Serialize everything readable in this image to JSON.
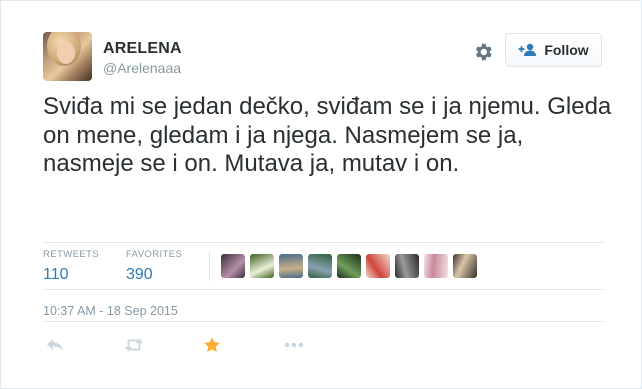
{
  "user": {
    "name": "ARELENA",
    "handle": "@Arelenaaa"
  },
  "follow_button": {
    "label": "Follow",
    "icon": "person-plus-icon"
  },
  "tweet": {
    "text": "Sviđa mi se jedan dečko, sviđam se i ja njemu. Gleda on mene, gledam i ja njega. Nasmejem se ja, nasmeje se i on. Mutava ja, mutav i on."
  },
  "stats": {
    "retweets_label": "RETWEETS",
    "retweets_value": "110",
    "favorites_label": "FAVORITES",
    "favorites_value": "390"
  },
  "favoriters": [
    {
      "color_a": "#3b2f3a",
      "color_b": "#b58fa8"
    },
    {
      "color_a": "#3f5e1e",
      "color_b": "#e9f0d8"
    },
    {
      "color_a": "#4a6b8a",
      "color_b": "#c9b08a"
    },
    {
      "color_a": "#2f5f3a",
      "color_b": "#8aa0b5"
    },
    {
      "color_a": "#1d2a1d",
      "color_b": "#6fa05a"
    },
    {
      "color_a": "#f3d9cf",
      "color_b": "#d0453a"
    },
    {
      "color_a": "#2a2a2a",
      "color_b": "#9a9a9a"
    },
    {
      "color_a": "#f4e0e4",
      "color_b": "#c78a98"
    },
    {
      "color_a": "#3a3028",
      "color_b": "#d8c4a8"
    }
  ],
  "timestamp": "10:37 AM - 18 Sep 2015",
  "actions": {
    "reply_icon": "reply-icon",
    "retweet_icon": "retweet-icon",
    "favorite_icon": "star-icon",
    "more_icon": "more-dots-icon",
    "favorite_color": "#ffac33",
    "inactive_color": "#ccd6dd"
  },
  "colors": {
    "link": "#2b7bb9",
    "text": "#292f33",
    "muted": "#8899a6",
    "border": "#e1e8ed"
  }
}
